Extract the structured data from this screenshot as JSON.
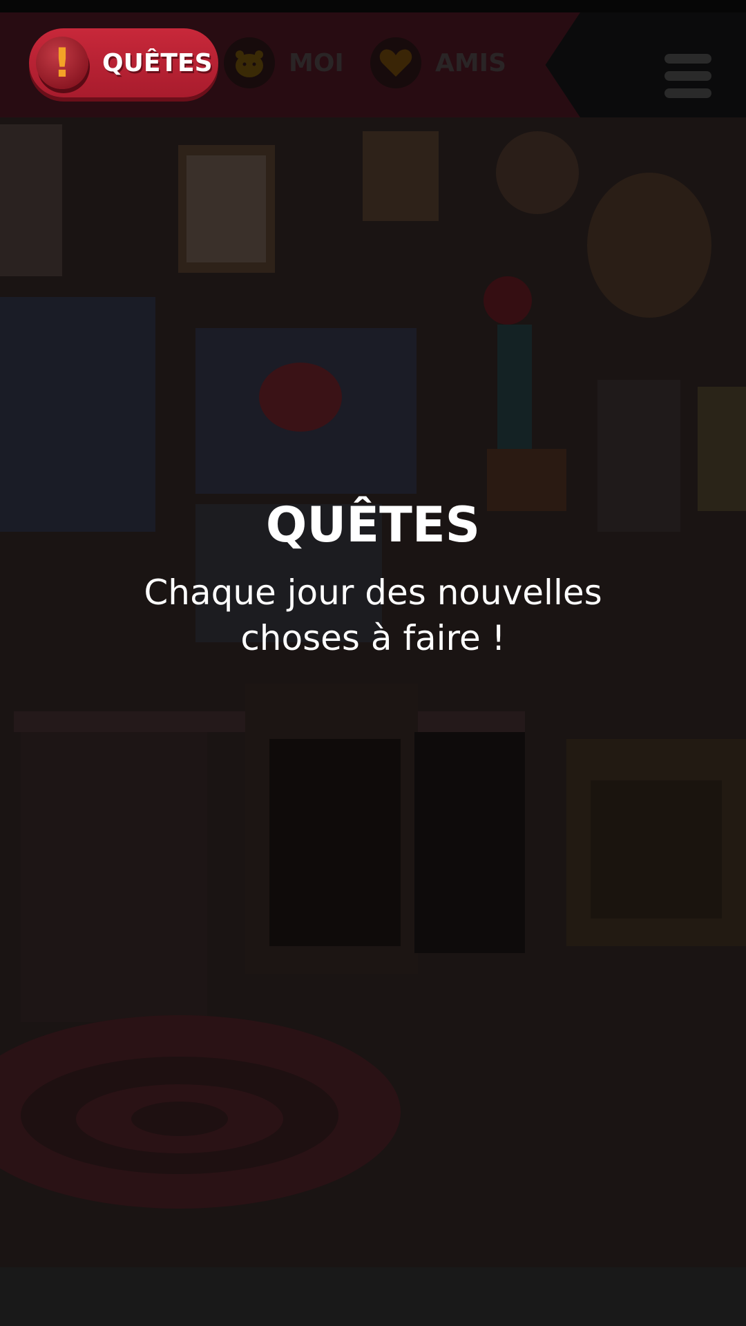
{
  "tabs": [
    {
      "label": "QUÊTES",
      "icon": "exclamation-icon",
      "active": true
    },
    {
      "label": "MOI",
      "icon": "hamster-face-icon",
      "active": false
    },
    {
      "label": "AMIS",
      "icon": "heart-icon",
      "active": false
    }
  ],
  "menu": {
    "icon": "hamburger-menu-icon"
  },
  "intro": {
    "title": "QUÊTES",
    "subtitle": "Chaque jour des nouvelles choses à faire !"
  },
  "colors": {
    "active_tab": "#c8283a",
    "exclamation": "#f4a227",
    "overlay_text": "#ffffff"
  }
}
